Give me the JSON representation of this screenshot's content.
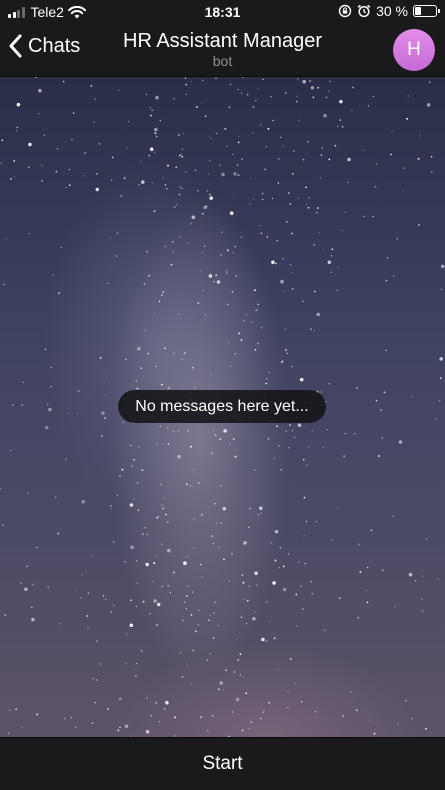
{
  "status_bar": {
    "carrier": "Tele2",
    "time": "18:31",
    "battery_text": "30 %",
    "battery_level": 0.3,
    "icons": [
      "signal-icon",
      "wifi-icon",
      "rotation-lock-icon",
      "alarm-icon",
      "battery-icon"
    ]
  },
  "header": {
    "back_label": "Chats",
    "title": "HR Assistant Manager",
    "subtitle": "bot",
    "avatar_initial": "H",
    "avatar_color": "#d57ae0"
  },
  "chat": {
    "empty_text": "No messages here yet..."
  },
  "footer": {
    "start_label": "Start"
  },
  "colors": {
    "bar_background": "#1a1a1c",
    "subtitle": "#8e8e93"
  }
}
